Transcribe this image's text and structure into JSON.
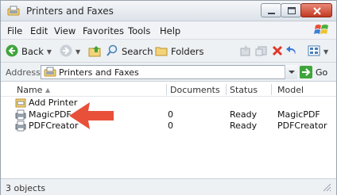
{
  "window": {
    "title": "Printers and Faxes"
  },
  "menu": {
    "items": [
      "File",
      "Edit",
      "View",
      "Favorites",
      "Tools",
      "Help"
    ]
  },
  "toolbar": {
    "back_label": "Back",
    "search_label": "Search",
    "folders_label": "Folders"
  },
  "address": {
    "label": "Address",
    "value": "Printers and Faxes",
    "go_label": "Go"
  },
  "list": {
    "columns": [
      "Name",
      "Documents",
      "Status",
      "Model"
    ],
    "sort_indicator": "▲",
    "rows": [
      {
        "name": "Add Printer",
        "documents": "",
        "status": "",
        "model": ""
      },
      {
        "name": "MagicPDF",
        "documents": "0",
        "status": "Ready",
        "model": "MagicPDF"
      },
      {
        "name": "PDFCreator",
        "documents": "0",
        "status": "Ready",
        "model": "PDFCreator"
      }
    ]
  },
  "status_bar": {
    "text": "3 objects"
  },
  "colors": {
    "arrow": "#e8503a",
    "go": "#3fa53b",
    "close": "#c23a22"
  }
}
